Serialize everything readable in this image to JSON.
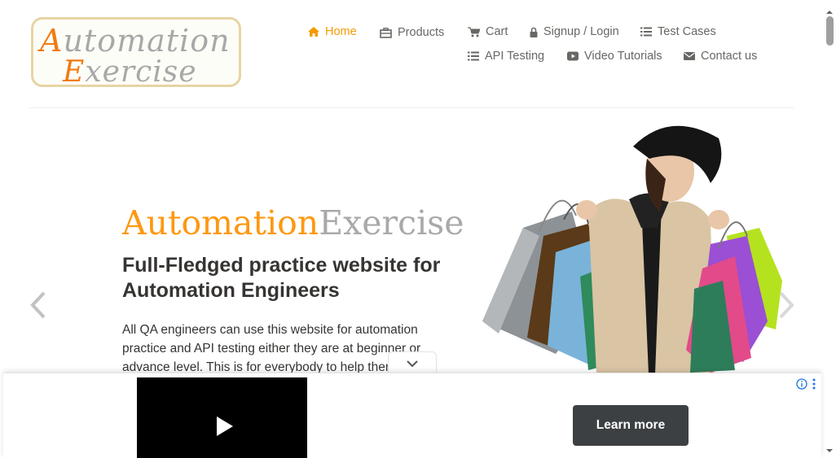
{
  "logo": {
    "line1_cap": "A",
    "line1_rest": "utomation",
    "line2_cap": "E",
    "line2_rest": "xercise"
  },
  "nav": {
    "home": "Home",
    "products": "Products",
    "cart": "Cart",
    "signup_login": "Signup / Login",
    "test_cases": "Test Cases",
    "api_testing": "API Testing",
    "video_tutorials": "Video Tutorials",
    "contact_us": "Contact us"
  },
  "slider": {
    "brand_part1": "Automation",
    "brand_part2": "Exercise",
    "headline": "Full-Fledged practice website for Automation Engineers",
    "description": "All QA engineers can use this website for automation practice and API testing either they are at beginner or advance level. This is for everybody to help them"
  },
  "ad": {
    "learn_more": "Learn more"
  },
  "colors": {
    "accent": "#fe980f",
    "nav_text": "#696763",
    "heading": "#363432",
    "ad_button": "#3c4043"
  },
  "icons": [
    "home-icon",
    "products-icon",
    "cart-icon",
    "lock-icon",
    "list-icon",
    "video-icon",
    "envelope-icon",
    "chevron-left-icon",
    "chevron-right-icon",
    "play-icon",
    "info-icon",
    "more-vert-icon",
    "chevron-down-icon"
  ]
}
